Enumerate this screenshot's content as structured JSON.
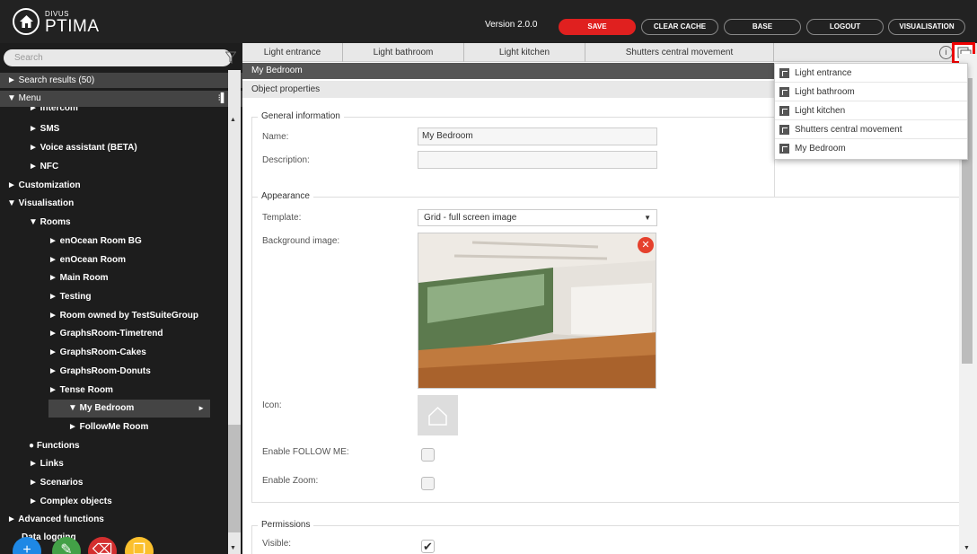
{
  "app": {
    "brand_small": "DIVUS",
    "brand_name": "PTIMA",
    "version": "Version 2.0.0"
  },
  "toolbar": {
    "save": "SAVE",
    "clear_cache": "CLEAR CACHE",
    "base": "BASE",
    "logout": "LOGOUT",
    "visualisation": "VISUALISATION"
  },
  "sidebar": {
    "search_placeholder": "Search",
    "search_results": "► Search results (50)",
    "menu_header": "▼ Menu",
    "items": [
      {
        "label": "► Intercom"
      },
      {
        "label": "► SMS"
      },
      {
        "label": "► Voice assistant (BETA)"
      },
      {
        "label": "► NFC"
      },
      {
        "label": "► Customization"
      },
      {
        "label": "▼ Visualisation"
      },
      {
        "label": "▼ Rooms"
      },
      {
        "label": "► enOcean Room BG"
      },
      {
        "label": "► enOcean Room"
      },
      {
        "label": "► Main Room"
      },
      {
        "label": "► Testing"
      },
      {
        "label": "► Room owned by TestSuiteGroup"
      },
      {
        "label": "► GraphsRoom-Timetrend"
      },
      {
        "label": "► GraphsRoom-Cakes"
      },
      {
        "label": "► GraphsRoom-Donuts"
      },
      {
        "label": "► Tense Room"
      },
      {
        "label": "▼ My Bedroom"
      },
      {
        "label": "► FollowMe Room"
      },
      {
        "label": "● Functions"
      },
      {
        "label": "► Links"
      },
      {
        "label": "► Scenarios"
      },
      {
        "label": "► Complex objects"
      },
      {
        "label": "► Advanced functions"
      },
      {
        "label": "Data logging"
      }
    ]
  },
  "tabs": [
    {
      "label": "Light entrance"
    },
    {
      "label": "Light bathroom"
    },
    {
      "label": "Light kitchen"
    },
    {
      "label": "Shutters central movement"
    }
  ],
  "object": {
    "title": "My Bedroom",
    "properties_label": "Object properties"
  },
  "general": {
    "legend": "General information",
    "name_label": "Name:",
    "name_value": "My Bedroom",
    "description_label": "Description:",
    "description_value": ""
  },
  "appearance": {
    "legend": "Appearance",
    "template_label": "Template:",
    "template_value": "Grid - full screen image",
    "bg_label": "Background image:",
    "icon_label": "Icon:",
    "follow_label": "Enable FOLLOW ME:",
    "follow_checked": false,
    "zoom_label": "Enable Zoom:",
    "zoom_checked": false
  },
  "permissions": {
    "legend": "Permissions",
    "visible_label": "Visible:",
    "visible_checked": true
  },
  "dropdown": {
    "items": [
      {
        "label": "Light entrance"
      },
      {
        "label": "Light bathroom"
      },
      {
        "label": "Light kitchen"
      },
      {
        "label": "Shutters central movement"
      },
      {
        "label": "My Bedroom"
      }
    ]
  },
  "colors": {
    "accent": "#e0201f",
    "topbar": "#222222",
    "sidebar": "#1d1d1d"
  }
}
